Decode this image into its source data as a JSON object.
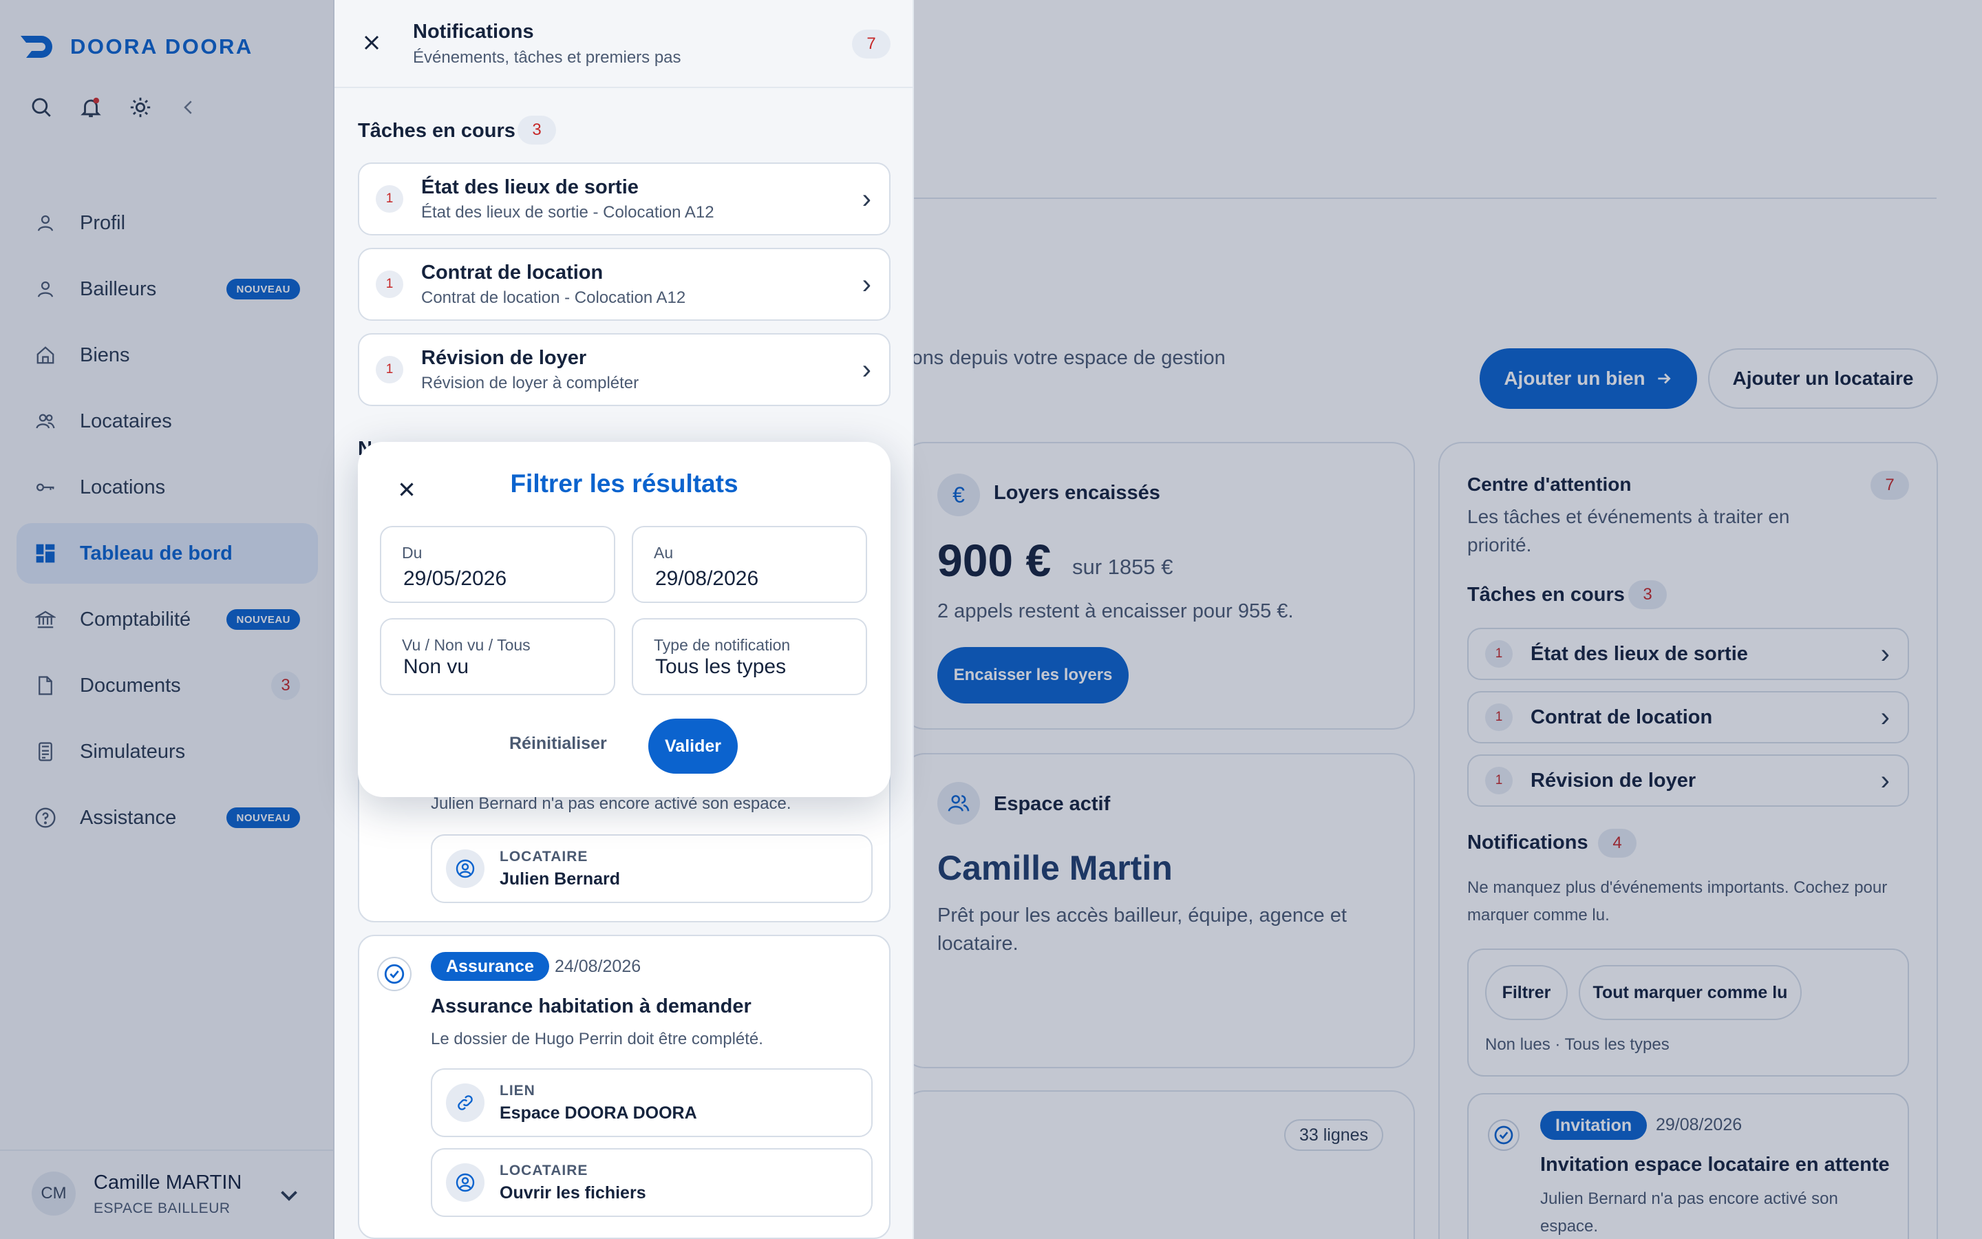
{
  "brand": {
    "name": "DOORA DOORA"
  },
  "sidebar": {
    "tools": [
      "search-icon",
      "bell-icon",
      "sun-icon",
      "chevron-left-icon"
    ],
    "items": [
      {
        "label": "Profil",
        "icon": "user-icon"
      },
      {
        "label": "Bailleurs",
        "icon": "user-icon",
        "badge": "NOUVEAU"
      },
      {
        "label": "Biens",
        "icon": "home-icon"
      },
      {
        "label": "Locataires",
        "icon": "users-icon"
      },
      {
        "label": "Locations",
        "icon": "key-icon"
      },
      {
        "label": "Tableau de bord",
        "icon": "dashboard-icon",
        "active": true
      },
      {
        "label": "Comptabilité",
        "icon": "bank-icon",
        "badge": "NOUVEAU"
      },
      {
        "label": "Documents",
        "icon": "document-icon",
        "count": "3"
      },
      {
        "label": "Simulateurs",
        "icon": "calculator-icon"
      },
      {
        "label": "Assistance",
        "icon": "help-icon",
        "badge": "NOUVEAU"
      }
    ],
    "user": {
      "initials": "CM",
      "name": "Camille MARTIN",
      "role": "ESPACE BAILLEUR"
    }
  },
  "main": {
    "subtitle_fragment": "tions depuis votre espace de gestion",
    "actions": {
      "add_property": "Ajouter un bien",
      "add_tenant": "Ajouter un locataire"
    },
    "rents": {
      "title": "Loyers encaissés",
      "amount": "900 €",
      "total": "sur 1855 €",
      "note": "2 appels restent à encaisser pour 955 €.",
      "button": "Encaisser les loyers"
    },
    "space": {
      "title": "Espace actif",
      "name": "Camille Martin",
      "note": "Prêt pour les accès bailleur, équipe, agence et locataire."
    },
    "rows_badge": "33 lignes",
    "attention": {
      "title": "Centre d'attention",
      "count": "7",
      "desc": "Les tâches et événements à traiter en priorité.",
      "tasks_title": "Tâches en cours",
      "tasks_count": "3",
      "tasks": [
        {
          "num": "1",
          "title": "État des lieux de sortie"
        },
        {
          "num": "1",
          "title": "Contrat de location"
        },
        {
          "num": "1",
          "title": "Révision de loyer"
        }
      ],
      "notifs_title": "Notifications",
      "notifs_count": "4",
      "notifs_desc": "Ne manquez plus d'événements importants. Cochez pour marquer comme lu.",
      "filter_button": "Filtrer",
      "mark_all_button": "Tout marquer comme lu",
      "filter_summary": "Non lues · Tous les types",
      "event": {
        "tag": "Invitation",
        "date": "29/08/2026",
        "title": "Invitation espace locataire en attente",
        "desc": "Julien Bernard n'a pas encore activé son espace."
      }
    }
  },
  "panel": {
    "title": "Notifications",
    "subtitle": "Événements, tâches et premiers pas",
    "count": "7",
    "tasks_title": "Tâches en cours",
    "tasks_count": "3",
    "tasks": [
      {
        "num": "1",
        "title": "État des lieux de sortie",
        "subtitle": "État des lieux de sortie - Colocation A12"
      },
      {
        "num": "1",
        "title": "Contrat de location",
        "subtitle": "Contrat de location - Colocation A12"
      },
      {
        "num": "1",
        "title": "Révision de loyer",
        "subtitle": "Révision de loyer à compléter"
      }
    ],
    "section_initial": "N",
    "event1": {
      "desc": "Julien Bernard n'a pas encore activé son espace.",
      "link": {
        "label": "LOCATAIRE",
        "value": "Julien Bernard"
      }
    },
    "event2": {
      "tag": "Assurance",
      "date": "24/08/2026",
      "title": "Assurance habitation à demander",
      "desc": "Le dossier de Hugo Perrin doit être complété.",
      "links": [
        {
          "label": "LIEN",
          "value": "Espace DOORA DOORA"
        },
        {
          "label": "LOCATAIRE",
          "value": "Ouvrir les fichiers"
        }
      ]
    }
  },
  "modal": {
    "title": "Filtrer les résultats",
    "from": {
      "label": "Du",
      "value": "29/05/2026"
    },
    "to": {
      "label": "Au",
      "value": "29/08/2026"
    },
    "seen": {
      "label": "Vu / Non vu / Tous",
      "value": "Non vu"
    },
    "type": {
      "label": "Type de notification",
      "value": "Tous les types"
    },
    "reset": "Réinitialiser",
    "submit": "Valider"
  },
  "colors": {
    "accent": "#0b63ce",
    "count_red": "#c62828",
    "overlay": "rgba(22,40,78,0.26)"
  }
}
